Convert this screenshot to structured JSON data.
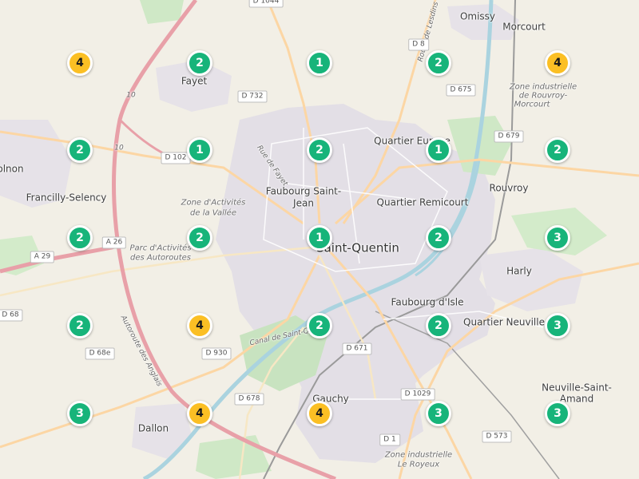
{
  "colors": {
    "cluster_green": "#17b47a",
    "cluster_yellow": "#fbbf24",
    "land": "#f2efe6",
    "urban": "#e3dfe6",
    "forest": "#c8e3c0",
    "water": "#aad3df",
    "motorway": "#e8a0a8",
    "primary": "#fcd6a4"
  },
  "places": [
    {
      "text": "Omissy",
      "cls": "town"
    },
    {
      "text": "Morcourt",
      "cls": "town"
    },
    {
      "text": "Fayet",
      "cls": "town"
    },
    {
      "text": "Zone industrielle",
      "cls": "zone"
    },
    {
      "text": "de Rouvroy-",
      "cls": "zone"
    },
    {
      "text": "Morcourt",
      "cls": "zone"
    },
    {
      "text": "Quartier Europe",
      "cls": "town"
    },
    {
      "text": "olnon",
      "cls": "town"
    },
    {
      "text": "Francilly-Selency",
      "cls": "town"
    },
    {
      "text": "Faubourg Saint-",
      "cls": "town"
    },
    {
      "text": "Jean",
      "cls": "town"
    },
    {
      "text": "Quartier Remicourt",
      "cls": "town"
    },
    {
      "text": "Rouvroy",
      "cls": "town"
    },
    {
      "text": "Zone d'Activités",
      "cls": "zone"
    },
    {
      "text": "de la Vallée",
      "cls": "zone"
    },
    {
      "text": "Saint-Quentin",
      "cls": "city"
    },
    {
      "text": "Parc d'Activités",
      "cls": "zone"
    },
    {
      "text": "des Autoroutes",
      "cls": "zone"
    },
    {
      "text": "Harly",
      "cls": "town"
    },
    {
      "text": "Faubourg d'Isle",
      "cls": "town"
    },
    {
      "text": "Quartier Neuville",
      "cls": "town"
    },
    {
      "text": "Gauchy",
      "cls": "town"
    },
    {
      "text": "Neuville-Saint-",
      "cls": "town"
    },
    {
      "text": "Amand",
      "cls": "town"
    },
    {
      "text": "Dallon",
      "cls": "town"
    },
    {
      "text": "Zone industrielle",
      "cls": "zone"
    },
    {
      "text": "Le Royeux",
      "cls": "zone"
    },
    {
      "text": "Rue de Fayet",
      "cls": "road"
    },
    {
      "text": "Route de Lesdins",
      "cls": "road"
    },
    {
      "text": "Autoroute des Anglais",
      "cls": "road"
    },
    {
      "text": "Canal de Saint-Quentin",
      "cls": "road"
    },
    {
      "text": "10",
      "cls": "road"
    },
    {
      "text": "10",
      "cls": "road"
    }
  ],
  "road_shields": [
    "D 1044",
    "D 8",
    "D 732",
    "D 675",
    "D 679",
    "D 102",
    "A 26",
    "A 29",
    "D 68",
    "D 68e",
    "D 930",
    "D 671",
    "D 678",
    "D 1029",
    "D 1",
    "D 573"
  ],
  "clusters": [
    {
      "count": "4",
      "color": "yellow"
    },
    {
      "count": "2",
      "color": "green"
    },
    {
      "count": "1",
      "color": "green"
    },
    {
      "count": "2",
      "color": "green"
    },
    {
      "count": "4",
      "color": "yellow"
    },
    {
      "count": "2",
      "color": "green"
    },
    {
      "count": "1",
      "color": "green"
    },
    {
      "count": "2",
      "color": "green"
    },
    {
      "count": "1",
      "color": "green"
    },
    {
      "count": "2",
      "color": "green"
    },
    {
      "count": "2",
      "color": "green"
    },
    {
      "count": "2",
      "color": "green"
    },
    {
      "count": "1",
      "color": "green"
    },
    {
      "count": "2",
      "color": "green"
    },
    {
      "count": "3",
      "color": "green"
    },
    {
      "count": "2",
      "color": "green"
    },
    {
      "count": "4",
      "color": "yellow"
    },
    {
      "count": "2",
      "color": "green"
    },
    {
      "count": "2",
      "color": "green"
    },
    {
      "count": "3",
      "color": "green"
    },
    {
      "count": "3",
      "color": "green"
    },
    {
      "count": "4",
      "color": "yellow"
    },
    {
      "count": "4",
      "color": "yellow"
    },
    {
      "count": "3",
      "color": "green"
    },
    {
      "count": "3",
      "color": "green"
    }
  ]
}
